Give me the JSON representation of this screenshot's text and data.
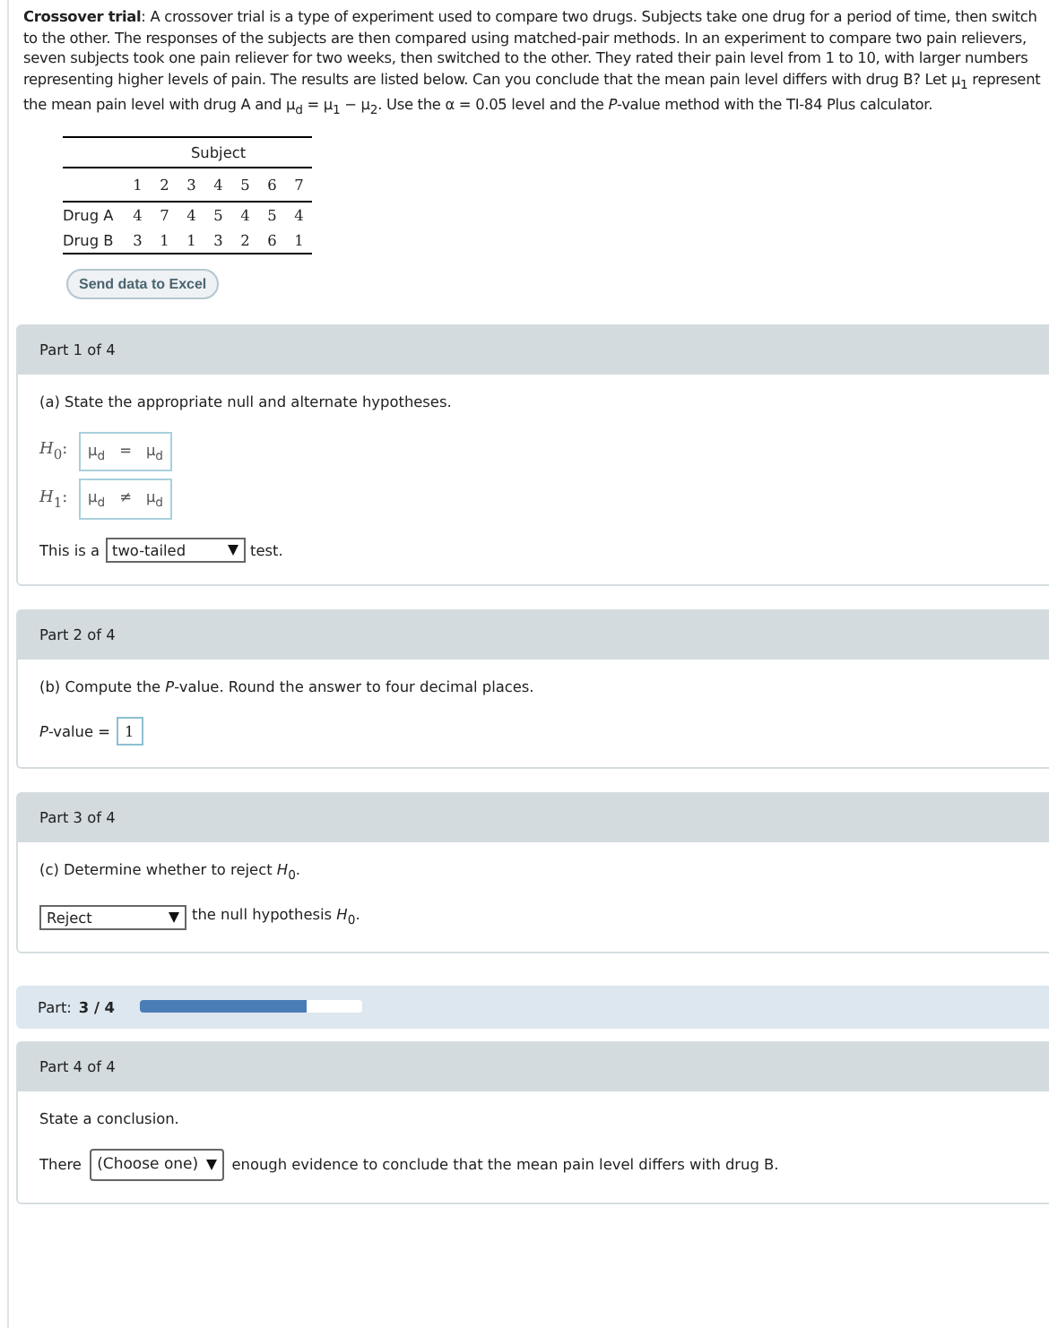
{
  "intro": "**Crossover trial**: A crossover trial is a type of experiment used to compare two drugs. Subjects take one drug for a period of time, then switch to the other. The responses of the subjects are then compared using matched-pair methods. In an experiment to compare two pain relievers, seven subjects took one pain reliever for two weeks, then switched to the other. They rated their pain level from 1 to 10, with larger numbers representing higher levels of pain. The results are listed below. Can you conclude that the mean pain level differs with drug B? Let μ$_{1}$ represent the mean pain level with drug A and μ$_{d}$ = μ$_{1}$ − μ$_{2}$. Use the α = 0.05  level and the *P*-value method with the TI-84 Plus calculator.",
  "table": {
    "caption": "Subject",
    "columns": [
      "1",
      "2",
      "3",
      "4",
      "5",
      "6",
      "7"
    ],
    "rows": [
      {
        "label": "Drug A",
        "values": [
          "4",
          "7",
          "4",
          "5",
          "4",
          "5",
          "4"
        ]
      },
      {
        "label": "Drug B",
        "values": [
          "3",
          "1",
          "1",
          "3",
          "2",
          "6",
          "1"
        ]
      }
    ]
  },
  "excel_button": "Send data to Excel",
  "parts": [
    {
      "kind": "hypotheses",
      "title": "Part 1 of 4",
      "prompt": "(a) State the appropriate null and alternate hypotheses.",
      "hypotheses": [
        {
          "label": "*H*$_{0}$:",
          "left": "μ$_{d}$",
          "op": "=",
          "right": "μ$_{d}$"
        },
        {
          "label": "*H*$_{1}$:",
          "left": "μ$_{d}$",
          "op": "≠",
          "right": "μ$_{d}$"
        }
      ],
      "prefix": "This is a",
      "value": "two-tailed",
      "suffix": "test."
    },
    {
      "kind": "value",
      "title": "Part 2 of 4",
      "prompt": "(b) Compute the *P*-value. Round the answer to four decimal places.",
      "prefix": "*P*-value =",
      "value": "1"
    },
    {
      "kind": "choice",
      "title": "Part 3 of 4",
      "prompt": "(c) Determine whether to reject *H*$_{0}$.",
      "value": "Reject",
      "suffix": "the null hypothesis *H*$_{0}$."
    },
    {
      "kind": "progress",
      "label": "Part:",
      "value": "3 / 4",
      "level": 0.75
    },
    {
      "kind": "sentence",
      "title": "Part 4 of 4",
      "prompt": "State a conclusion.",
      "prefix": "There",
      "value": "(Choose one)",
      "suffix": "enough evidence to conclude that the mean pain level differs with drug B."
    }
  ]
}
